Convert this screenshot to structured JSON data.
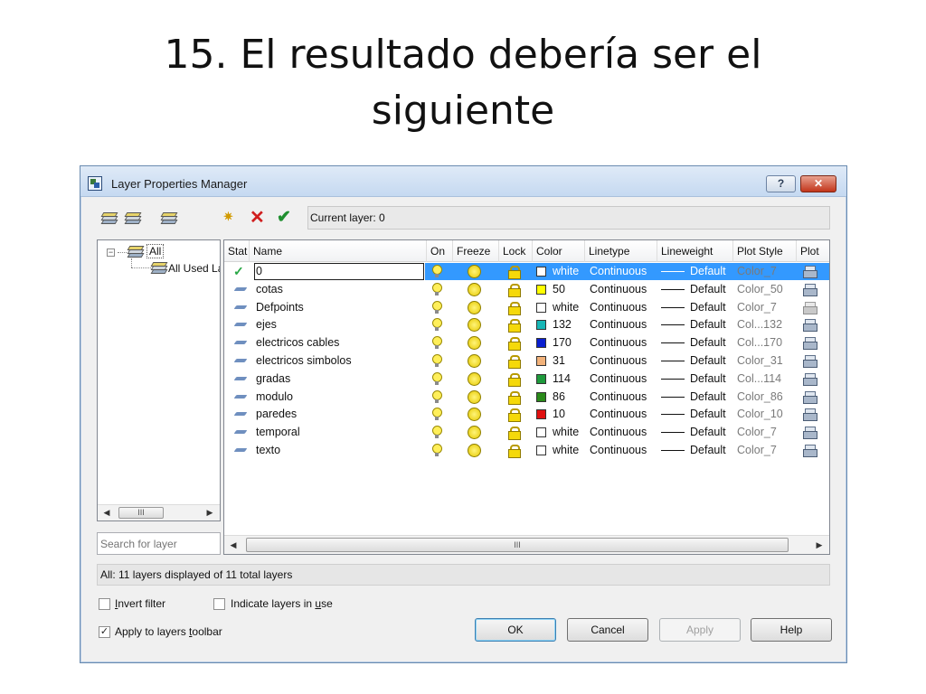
{
  "slide": {
    "title_line1": "15. El resultado debería ser el",
    "title_line2": "siguiente"
  },
  "dialog": {
    "title": "Layer Properties Manager",
    "help_label": "?",
    "close_label": "✕",
    "current_layer": "Current layer: 0"
  },
  "tree": {
    "expand_symbol": "−",
    "all_label": "All",
    "used_label": "All Used Layers"
  },
  "search": {
    "placeholder": "Search for layer"
  },
  "scrollbar": {
    "left_arrow": "◀",
    "right_arrow": "▶",
    "thumb_grip": "III"
  },
  "columns": {
    "status": "Stat",
    "name": "Name",
    "on": "On",
    "freeze": "Freeze",
    "lock": "Lock",
    "color": "Color",
    "linetype": "Linetype",
    "lineweight": "Lineweight",
    "plot_style": "Plot Style",
    "plot": "Plot"
  },
  "layers": [
    {
      "name": "0",
      "color_name": "white",
      "color_hex": "#ffffff",
      "linetype": "Continuous",
      "lineweight": "Default",
      "plot_style": "Color_7",
      "current": true
    },
    {
      "name": "cotas",
      "color_name": "50",
      "color_hex": "#ffff00",
      "linetype": "Continuous",
      "lineweight": "Default",
      "plot_style": "Color_50"
    },
    {
      "name": "Defpoints",
      "color_name": "white",
      "color_hex": "#ffffff",
      "linetype": "Continuous",
      "lineweight": "Default",
      "plot_style": "Color_7",
      "plot_disabled": true
    },
    {
      "name": "ejes",
      "color_name": "132",
      "color_hex": "#17b6b6",
      "linetype": "Continuous",
      "lineweight": "Default",
      "plot_style": "Col...132"
    },
    {
      "name": "electricos cables",
      "color_name": "170",
      "color_hex": "#0a1fd0",
      "linetype": "Continuous",
      "lineweight": "Default",
      "plot_style": "Col...170"
    },
    {
      "name": "electricos simbolos",
      "color_name": "31",
      "color_hex": "#f2b27a",
      "linetype": "Continuous",
      "lineweight": "Default",
      "plot_style": "Color_31"
    },
    {
      "name": "gradas",
      "color_name": "114",
      "color_hex": "#1e9a3c",
      "linetype": "Continuous",
      "lineweight": "Default",
      "plot_style": "Col...114"
    },
    {
      "name": "modulo",
      "color_name": "86",
      "color_hex": "#2a8a1a",
      "linetype": "Continuous",
      "lineweight": "Default",
      "plot_style": "Color_86"
    },
    {
      "name": "paredes",
      "color_name": "10",
      "color_hex": "#e01010",
      "linetype": "Continuous",
      "lineweight": "Default",
      "plot_style": "Color_10"
    },
    {
      "name": "temporal",
      "color_name": "white",
      "color_hex": "#ffffff",
      "linetype": "Continuous",
      "lineweight": "Default",
      "plot_style": "Color_7"
    },
    {
      "name": "texto",
      "color_name": "white",
      "color_hex": "#ffffff",
      "linetype": "Continuous",
      "lineweight": "Default",
      "plot_style": "Color_7"
    }
  ],
  "status": {
    "text": "All: 11 layers displayed of 11 total layers"
  },
  "options": {
    "invert_filter": {
      "prefix": "",
      "accel": "I",
      "rest": "nvert filter",
      "checked": false
    },
    "indicate_layers": {
      "prefix": "Indicate layers in ",
      "accel": "u",
      "rest": "se",
      "checked": false
    },
    "apply_toolbar": {
      "prefix": "Apply to layers ",
      "accel": "t",
      "rest": "oolbar",
      "checked": true
    },
    "check_mark": "✓"
  },
  "buttons": {
    "ok": "OK",
    "cancel": "Cancel",
    "apply": "Apply",
    "help": "Help"
  },
  "colors": {
    "selection": "#3399ff",
    "accent_blue": "#6f8fbf"
  }
}
